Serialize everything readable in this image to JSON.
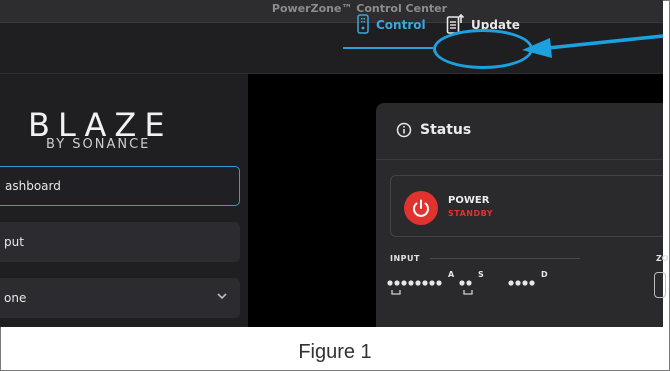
{
  "window": {
    "title": "PowerZone™ Control Center"
  },
  "nav": {
    "tabs": [
      {
        "label": "Control",
        "icon": "remote-icon",
        "active": true
      },
      {
        "label": "Update",
        "icon": "document-update-icon",
        "active": false
      }
    ]
  },
  "sidebar": {
    "brand": {
      "name": "BLAZE",
      "subtitle": "BY SONANCE"
    },
    "items": [
      {
        "label": "ashboard",
        "active": true
      },
      {
        "label": "put",
        "active": false
      },
      {
        "label": "one",
        "active": false,
        "has_dropdown": true
      }
    ]
  },
  "status": {
    "title": "Status",
    "power": {
      "label": "POWER",
      "state": "STANDBY"
    },
    "input": {
      "label": "INPUT",
      "group_letters": [
        "A",
        "S",
        "D"
      ],
      "dot_counts": [
        8,
        2,
        4
      ]
    },
    "zone_label_partial": "ZO"
  },
  "caption": "Figure 1",
  "colors": {
    "accent": "#2f9fd9",
    "callout": "#1da0e0",
    "power_red": "#e0332f",
    "background": "#1d1d1f"
  }
}
